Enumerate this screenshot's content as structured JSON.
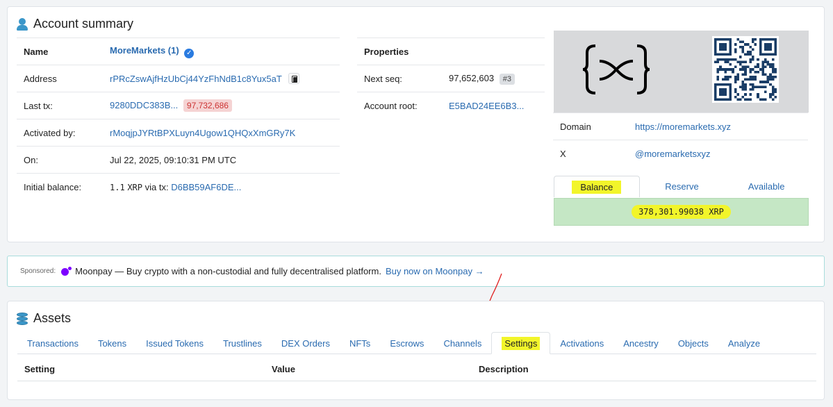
{
  "summary": {
    "title": "Account summary",
    "rows": [
      {
        "label": "Name",
        "value": "MoreMarkets (1)"
      },
      {
        "label": "Address",
        "value": "rPRcZswAjfHzUbCj44YzFhNdB1c8Yux5aT"
      },
      {
        "label": "Last tx:",
        "value": "9280DDC383B...",
        "badge": "97,732,686"
      },
      {
        "label": "Activated by:",
        "value": "rMoqjpJYRtBPXLuyn4Ugow1QHQxXmGRy7K"
      },
      {
        "label": "On:",
        "value": "Jul 22, 2025, 09:10:31 PM UTC"
      },
      {
        "label": "Initial balance:",
        "amount": "1.1",
        "currency": "XRP",
        "via": "via tx:",
        "tx": "D6BB59AF6DE..."
      }
    ],
    "properties": {
      "header": "Properties",
      "next_seq_label": "Next seq:",
      "next_seq_value": "97,652,603",
      "next_seq_badge": "#3",
      "account_root_label": "Account root:",
      "account_root_value": "E5BAD24EE6B3..."
    },
    "right": {
      "domain_label": "Domain",
      "domain_value": "https://moremarkets.xyz",
      "x_label": "X",
      "x_value": "@moremarketsxyz"
    },
    "balance_tabs": [
      "Balance",
      "Reserve",
      "Available"
    ],
    "balance_value": "378,301.99038 XRP"
  },
  "sponsor": {
    "label": "Sponsored:",
    "text": "Moonpay — Buy crypto with a non-custodial and fully decentralised platform.",
    "link": "Buy now on Moonpay →"
  },
  "assets": {
    "title": "Assets",
    "tabs": [
      "Transactions",
      "Tokens",
      "Issued Tokens",
      "Trustlines",
      "DEX Orders",
      "NFTs",
      "Escrows",
      "Channels",
      "Settings",
      "Activations",
      "Ancestry",
      "Objects",
      "Analyze"
    ],
    "active_tab": "Settings",
    "columns": [
      "Setting",
      "Value",
      "Description"
    ]
  },
  "colors": {
    "link": "#2a6bb0",
    "highlight": "#f2f52a",
    "balance_bg": "#c5e7c5",
    "annotation_arrow": "#e02020"
  }
}
